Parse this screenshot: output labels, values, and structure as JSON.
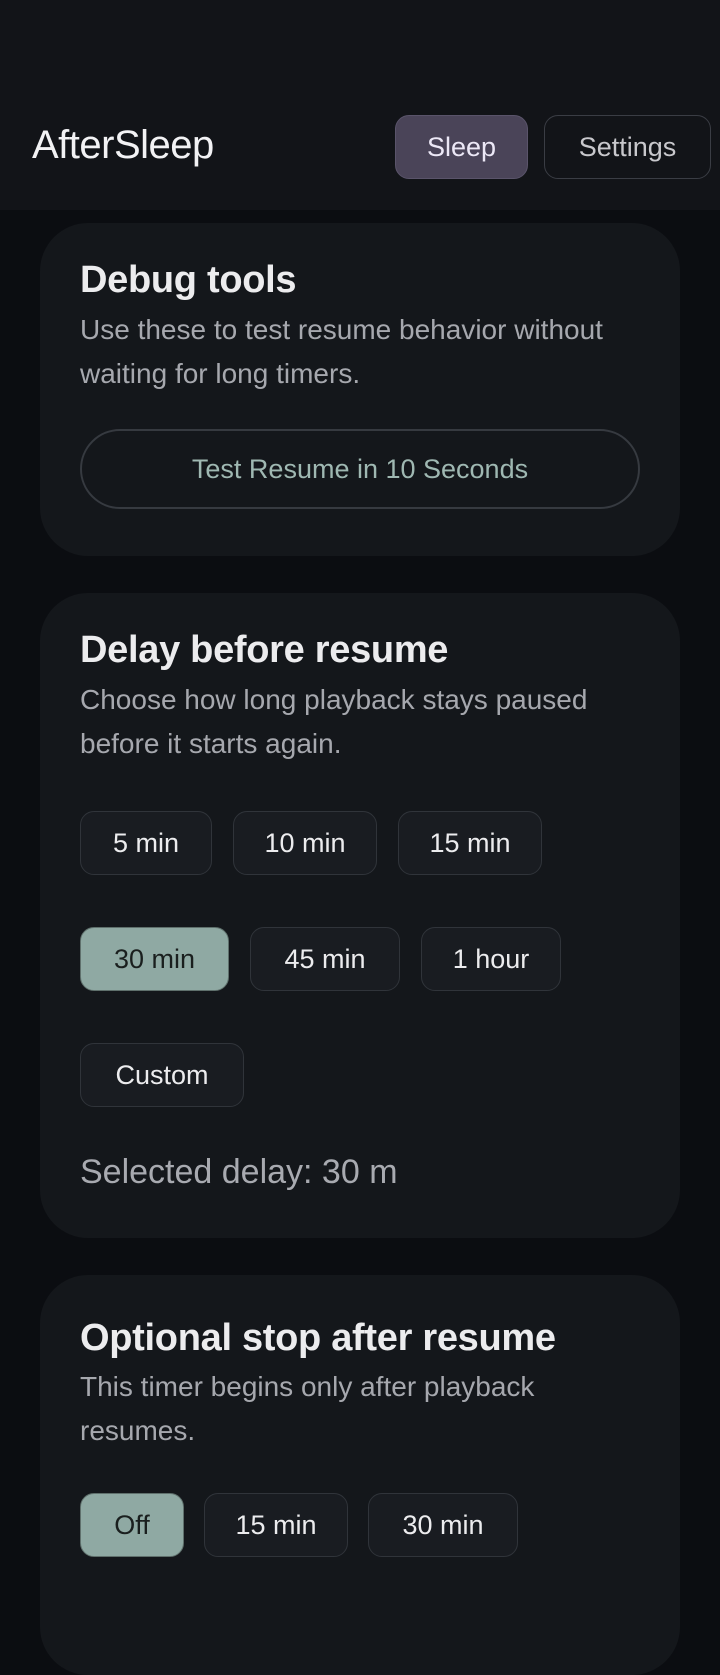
{
  "app": {
    "title": "AfterSleep"
  },
  "nav": {
    "sleep_label": "Sleep",
    "settings_label": "Settings",
    "active": "Sleep"
  },
  "debug": {
    "title": "Debug tools",
    "description": "Use these to test resume behavior without waiting for long timers.",
    "test_button_label": "Test Resume in 10 Seconds"
  },
  "delay": {
    "title": "Delay before resume",
    "description": "Choose how long playback stays paused before it starts again.",
    "options": [
      "5 min",
      "10 min",
      "15 min",
      "30 min",
      "45 min",
      "1 hour",
      "Custom"
    ],
    "selected": "30 min",
    "selected_text": "Selected delay: 30 m"
  },
  "stop": {
    "title": "Optional stop after resume",
    "description": "This timer begins only after playback resumes.",
    "options": [
      "Off",
      "15 min",
      "30 min"
    ],
    "selected": "Off"
  },
  "colors": {
    "background": "#0b0d11",
    "card": "#14171b",
    "accent_selected": "#8fa9a3",
    "nav_active": "#4a4458",
    "test_button_text": "#9fb8b2"
  }
}
